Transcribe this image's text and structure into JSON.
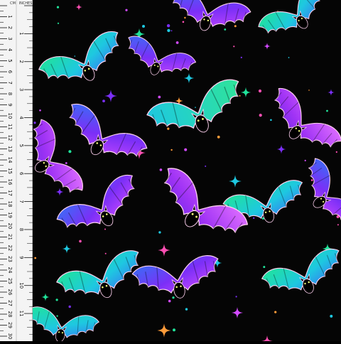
{
  "ruler": {
    "unit_cm": "CM",
    "unit_in": "INCHES",
    "cm_labels": [
      "1",
      "2",
      "3",
      "4",
      "5",
      "6",
      "7",
      "8",
      "9",
      "10",
      "11",
      "12",
      "13",
      "14",
      "15",
      "16",
      "17",
      "18",
      "19",
      "20",
      "21",
      "22",
      "23",
      "24",
      "25",
      "26",
      "27",
      "28",
      "29",
      "30"
    ],
    "inch_labels": [
      "1",
      "2",
      "3",
      "4",
      "5",
      "6",
      "7",
      "8",
      "9",
      "10",
      "11",
      "12"
    ]
  },
  "pattern": {
    "background": "#050505",
    "motif": "bat-icon",
    "accent_colors": [
      "#7b2ff7",
      "#1ec8e0",
      "#20e39a",
      "#d24bff",
      "#ff9c3a",
      "#ff4fb3"
    ]
  }
}
